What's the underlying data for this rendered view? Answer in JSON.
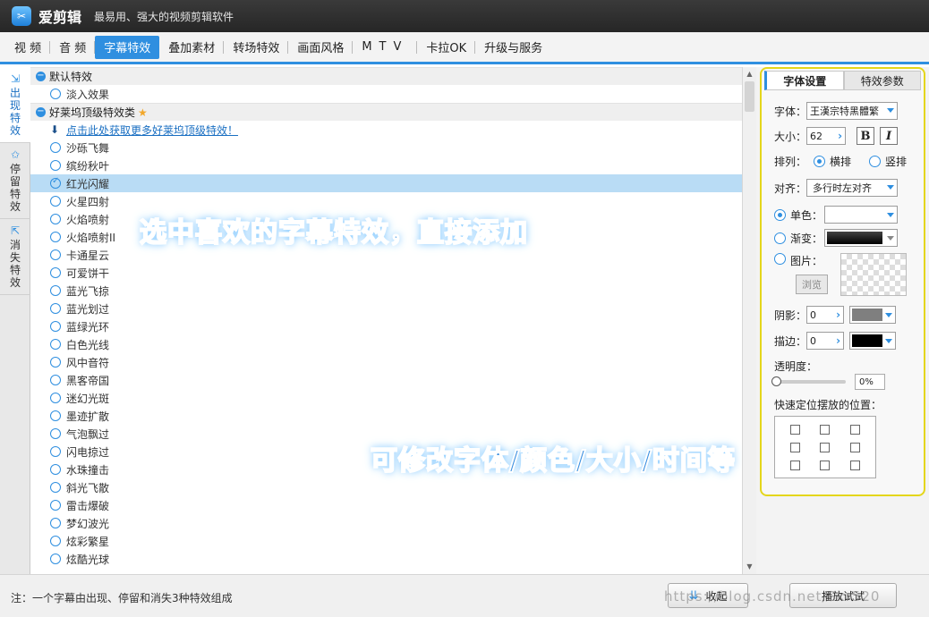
{
  "titlebar": {
    "logo_glyph": "✂",
    "title": "爱剪辑",
    "slogan": "最易用、强大的视频剪辑软件"
  },
  "menu": [
    {
      "label": "视 频"
    },
    {
      "label": "音 频"
    },
    {
      "label": "字幕特效",
      "active": true
    },
    {
      "label": "叠加素材"
    },
    {
      "label": "转场特效"
    },
    {
      "label": "画面风格"
    },
    {
      "label": "MTV"
    },
    {
      "label": "卡拉OK"
    },
    {
      "label": "升级与服务"
    }
  ],
  "vtabs": [
    {
      "label": "出现特效",
      "icon": "enter-icon",
      "glyph": "⇲"
    },
    {
      "label": "停留特效",
      "icon": "star-outline-icon",
      "glyph": "✩"
    },
    {
      "label": "消失特效",
      "icon": "exit-icon",
      "glyph": "⇱"
    }
  ],
  "groups": {
    "default": {
      "label": "默认特效",
      "items": [
        "淡入效果"
      ]
    },
    "hollywood": {
      "label": "好莱坞顶级特效类",
      "download_link": "点击此处获取更多好莱坞顶级特效！",
      "items": [
        "沙砾飞舞",
        "缤纷秋叶",
        "红光闪耀",
        "火星四射",
        "火焰喷射",
        "火焰喷射II",
        "卡通星云",
        "可爱饼干",
        "蓝光飞掠",
        "蓝光划过",
        "蓝绿光环",
        "白色光线",
        "风中音符",
        "黑客帝国",
        "迷幻光斑",
        "墨迹扩散",
        "气泡飘过",
        "闪电掠过",
        "水珠撞击",
        "斜光飞散",
        "雷击爆破",
        "梦幻波光",
        "炫彩繁星",
        "炫酷光球"
      ],
      "selected": "红光闪耀"
    }
  },
  "overlays": {
    "caption1": "选中喜欢的字幕特效，直接添加",
    "caption2": "可修改字体/颜色/大小/时间等"
  },
  "panel": {
    "tabs": [
      "字体设置",
      "特效参数"
    ],
    "font_label": "字体：",
    "font_value": "王漢宗特黑體繁",
    "size_label": "大小：",
    "size_value": "62",
    "bold_label": "B",
    "italic_label": "I",
    "arrange_label": "排列：",
    "arrange_options": [
      "横排",
      "竖排"
    ],
    "arrange_selected": "横排",
    "align_label": "对齐：",
    "align_value": "多行时左对齐",
    "solid_label": "单色：",
    "gradient_label": "渐变：",
    "image_label": "图片：",
    "browse_label": "浏览",
    "shadow_label": "阴影：",
    "shadow_value": "0",
    "shadow_color": "#7f7f7f",
    "stroke_label": "描边：",
    "stroke_value": "0",
    "stroke_color": "#000000",
    "opacity_label": "透明度：",
    "opacity_value": "0%",
    "opacity_fraction": 0,
    "position_label": "快速定位摆放的位置："
  },
  "bottom": {
    "note": "注：一个字幕由出现、停留和消失3种特效组成",
    "collapse_label": "收起",
    "play_label": "播放试试",
    "watermark": "https://blog.csdn.net/Skr520"
  },
  "colors": {
    "accent": "#2f8fe0",
    "highlight_border": "#e4d61b",
    "selected_row": "#b9dcf5"
  }
}
